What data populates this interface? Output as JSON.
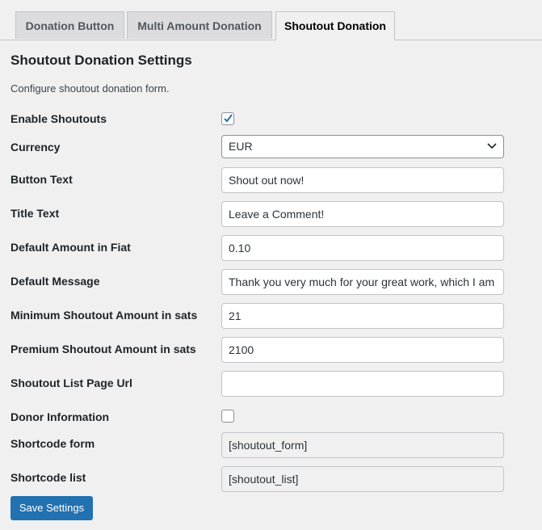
{
  "tabs": [
    {
      "label": "Donation Button"
    },
    {
      "label": "Multi Amount Donation"
    },
    {
      "label": "Shoutout Donation"
    }
  ],
  "heading": "Shoutout Donation Settings",
  "description": "Configure shoutout donation form.",
  "fields": {
    "enable_shoutouts": {
      "label": "Enable Shoutouts",
      "checked": true
    },
    "currency": {
      "label": "Currency",
      "value": "EUR"
    },
    "button_text": {
      "label": "Button Text",
      "value": "Shout out now!"
    },
    "title_text": {
      "label": "Title Text",
      "value": "Leave a Comment!"
    },
    "default_amount": {
      "label": "Default Amount in Fiat",
      "value": "0.10"
    },
    "default_message": {
      "label": "Default Message",
      "value": "Thank you very much for your great work, which I am"
    },
    "min_amount": {
      "label": "Minimum Shoutout Amount in sats",
      "value": "21"
    },
    "premium_amount": {
      "label": "Premium Shoutout Amount in sats",
      "value": "2100"
    },
    "list_page_url": {
      "label": "Shoutout List Page Url",
      "value": ""
    },
    "donor_info": {
      "label": "Donor Information",
      "checked": false
    },
    "shortcode_form": {
      "label": "Shortcode form",
      "value": "[shoutout_form]"
    },
    "shortcode_list": {
      "label": "Shortcode list",
      "value": "[shoutout_list]"
    }
  },
  "save_label": "Save Settings",
  "colors": {
    "primary": "#2271b1",
    "background": "#f0f0f1"
  }
}
